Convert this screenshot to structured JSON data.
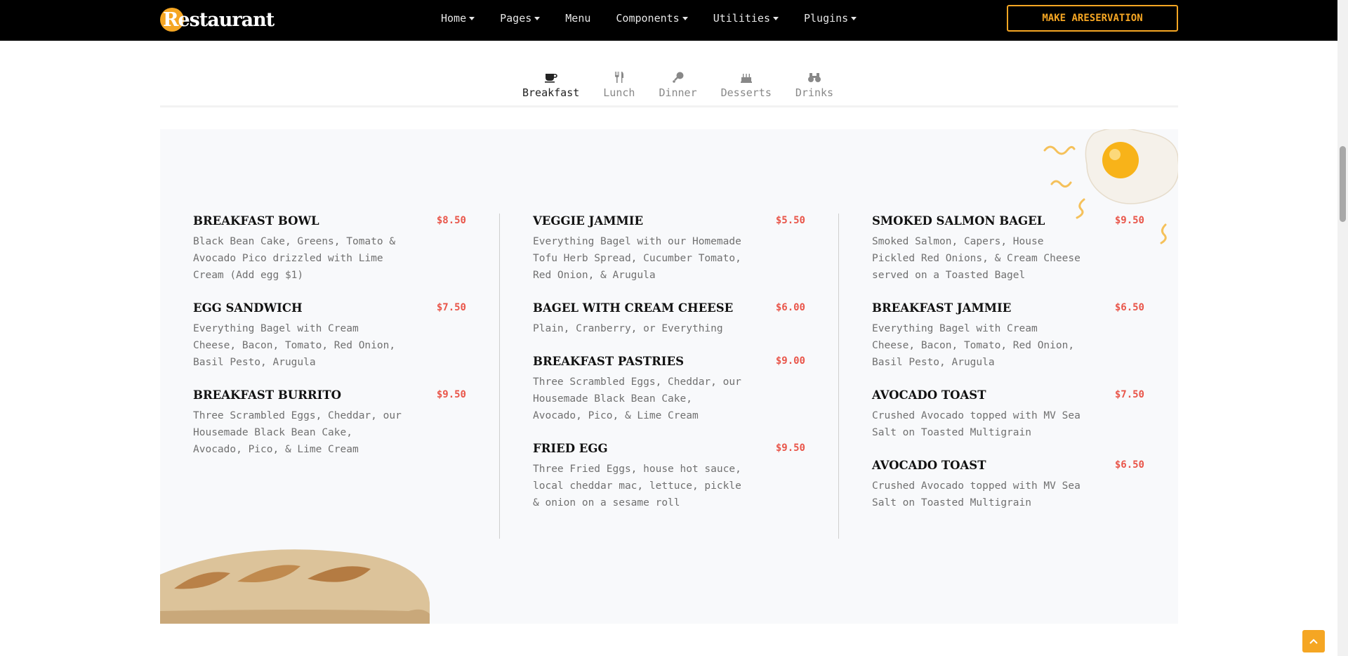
{
  "brand": {
    "name": "Restaurant"
  },
  "nav": {
    "items": [
      {
        "label": "Home",
        "dropdown": true
      },
      {
        "label": "Pages",
        "dropdown": true
      },
      {
        "label": "Menu",
        "dropdown": false
      },
      {
        "label": "Components",
        "dropdown": true
      },
      {
        "label": "Utilities",
        "dropdown": true
      },
      {
        "label": "Plugins",
        "dropdown": true
      }
    ],
    "cta_label": "MAKE ARESERVATION"
  },
  "tabs": [
    {
      "label": "Breakfast",
      "icon": "coffee-cup-icon",
      "active": true
    },
    {
      "label": "Lunch",
      "icon": "fork-knife-icon",
      "active": false
    },
    {
      "label": "Dinner",
      "icon": "drumstick-icon",
      "active": false
    },
    {
      "label": "Desserts",
      "icon": "cake-icon",
      "active": false
    },
    {
      "label": "Drinks",
      "icon": "binoculars-icon",
      "active": false
    }
  ],
  "menu": {
    "columns": [
      [
        {
          "name": "Breakfast Bowl",
          "price": "$8.50",
          "desc": "Black Bean Cake, Greens, Tomato & Avocado Pico drizzled with Lime Cream (Add egg $1)"
        },
        {
          "name": "Egg Sandwich",
          "price": "$7.50",
          "desc": "Everything Bagel with Cream Cheese, Bacon, Tomato, Red Onion, Basil Pesto, Arugula"
        },
        {
          "name": "Breakfast Burrito",
          "price": "$9.50",
          "desc": "Three Scrambled Eggs, Cheddar, our Housemade Black Bean Cake, Avocado, Pico, & Lime Cream"
        }
      ],
      [
        {
          "name": "Veggie Jammie",
          "price": "$5.50",
          "desc": "Everything Bagel with our Homemade Tofu Herb Spread, Cucumber Tomato, Red Onion, & Arugula"
        },
        {
          "name": "Bagel With Cream Cheese",
          "price": "$6.00",
          "desc": "Plain, Cranberry, or Everything"
        },
        {
          "name": "Breakfast Pastries",
          "price": "$9.00",
          "desc": "Three Scrambled Eggs, Cheddar, our Housemade Black Bean Cake, Avocado, Pico, & Lime Cream"
        },
        {
          "name": "Fried Egg",
          "price": "$9.50",
          "desc": "Three Fried Eggs, house hot sauce, local cheddar mac, lettuce, pickle & onion on a sesame roll"
        }
      ],
      [
        {
          "name": "Smoked Salmon Bagel",
          "price": "$9.50",
          "desc": "Smoked Salmon, Capers, House Pickled Red Onions, & Cream Cheese served on a Toasted Bagel"
        },
        {
          "name": "Breakfast Jammie",
          "price": "$6.50",
          "desc": "Everything Bagel with Cream Cheese, Bacon, Tomato, Red Onion, Basil Pesto, Arugula"
        },
        {
          "name": "Avocado Toast",
          "price": "$7.50",
          "desc": "Crushed Avocado topped with MV Sea Salt on Toasted Multigrain"
        },
        {
          "name": "Avocado Toast",
          "price": "$6.50",
          "desc": "Crushed Avocado topped with MV Sea Salt on Toasted Multigrain"
        }
      ]
    ]
  },
  "colors": {
    "accent": "#f5a623",
    "price": "#e9564a",
    "nav_bg": "#000000",
    "panel_bg": "#f8f9fb"
  }
}
